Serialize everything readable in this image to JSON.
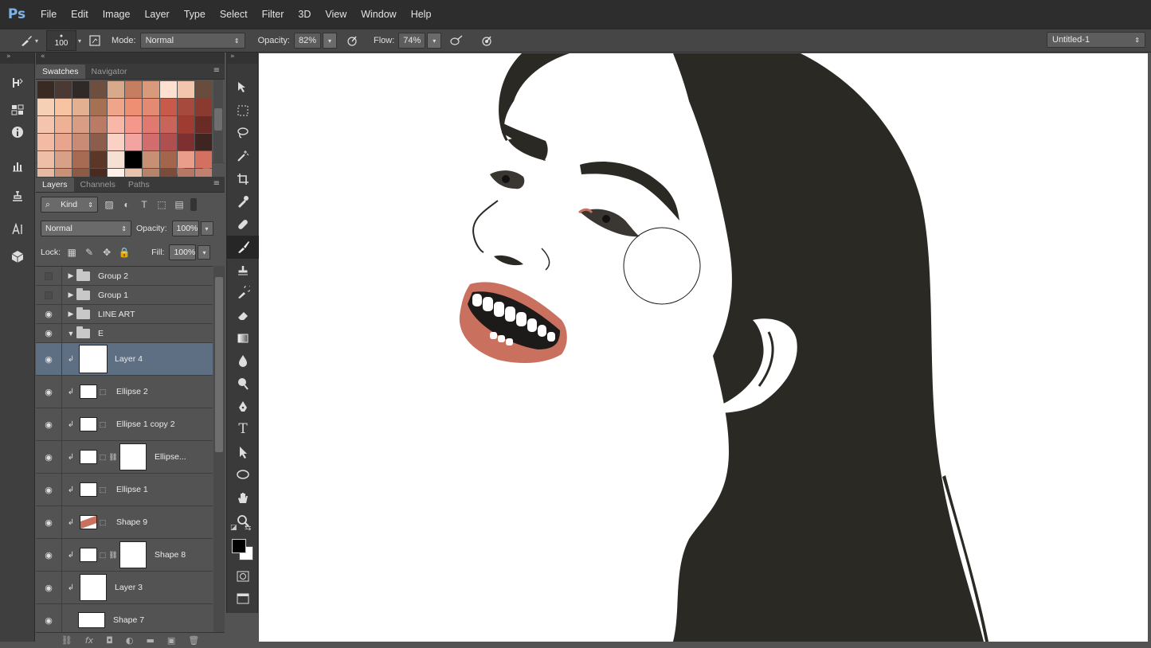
{
  "app": {
    "logo": "Ps"
  },
  "menu": [
    "File",
    "Edit",
    "Image",
    "Layer",
    "Type",
    "Select",
    "Filter",
    "3D",
    "View",
    "Window",
    "Help"
  ],
  "options": {
    "brush_size": "100",
    "mode_label": "Mode:",
    "mode_value": "Normal",
    "opacity_label": "Opacity:",
    "opacity_value": "82%",
    "flow_label": "Flow:",
    "flow_value": "74%",
    "document": "Untitled-1"
  },
  "swatches_panel": {
    "tabs": [
      "Swatches",
      "Navigator"
    ],
    "colors": [
      "#3a2a24",
      "#4a3a33",
      "#2f2a27",
      "#6e4e3e",
      "#d9a98b",
      "#c57e61",
      "#d99a7b",
      "#fde0cf",
      "#f2c5ad",
      "#6a4c3d",
      "#f6d0b5",
      "#f7c3a2",
      "#e3b092",
      "#a67052",
      "#f0a48a",
      "#ee8f74",
      "#e48a72",
      "#c75a4a",
      "#a54a3c",
      "#8a3a2f",
      "#f5c4ae",
      "#efb195",
      "#d99c84",
      "#b97a66",
      "#f9b7a7",
      "#f5978a",
      "#e07a70",
      "#c9645b",
      "#9e3c32",
      "#6b2a24",
      "#f3baa4",
      "#e9a48e",
      "#c98a76",
      "#8c5c4c",
      "#fbd0c5",
      "#f3a3a0",
      "#d36d6d",
      "#b04f4f",
      "#7e2f2f",
      "#3f2522",
      "#eebfa6",
      "#d8a086",
      "#a66b52",
      "#5c3627",
      "#f6e0d4",
      "#000000",
      "#c78f74",
      "#a3654c",
      "#ea9d8b",
      "#d47060",
      "#e6b9a1",
      "#c99276",
      "#8d5a45",
      "#4a2b20",
      "#fff1e8",
      "#e8c2ad",
      "#b5826a",
      "#7b4c3a",
      "#b77863",
      "#c28070"
    ]
  },
  "layers_panel": {
    "tabs": [
      "Layers",
      "Channels",
      "Paths"
    ],
    "kind": "Kind",
    "blend_mode": "Normal",
    "opacity_label": "Opacity:",
    "opacity_value": "100%",
    "lock_label": "Lock:",
    "fill_label": "Fill:",
    "fill_value": "100%",
    "layers": [
      {
        "name": "Group 2",
        "type": "group",
        "visible": false
      },
      {
        "name": "Group 1",
        "type": "group",
        "visible": false
      },
      {
        "name": "LINE ART",
        "type": "group",
        "visible": true
      },
      {
        "name": "E",
        "type": "group-open",
        "visible": true
      },
      {
        "name": "Layer 4",
        "type": "pixel",
        "visible": true,
        "selected": true
      },
      {
        "name": "Ellipse 2",
        "type": "shape",
        "visible": true
      },
      {
        "name": "Ellipse 1 copy 2",
        "type": "shape",
        "visible": true
      },
      {
        "name": "Ellipse...",
        "type": "shape-mask",
        "visible": true
      },
      {
        "name": "Ellipse 1",
        "type": "shape",
        "visible": true
      },
      {
        "name": "Shape 9",
        "type": "shape",
        "visible": true
      },
      {
        "name": "Shape 8",
        "type": "shape-mask",
        "visible": true
      },
      {
        "name": "Layer 3",
        "type": "pixel",
        "visible": true
      },
      {
        "name": "Shape 7",
        "type": "shape",
        "visible": true
      }
    ]
  },
  "tools": [
    "move",
    "marquee",
    "lasso",
    "magic-wand",
    "crop",
    "eyedropper",
    "healing",
    "brush",
    "stamp",
    "history-brush",
    "eraser",
    "gradient",
    "blur",
    "dodge",
    "pen",
    "type",
    "path-select",
    "ellipse",
    "hand",
    "zoom"
  ],
  "colors": {
    "foreground": "#000000",
    "background": "#ffffff",
    "hair": "#2b2924",
    "lips": "#c9705f"
  }
}
